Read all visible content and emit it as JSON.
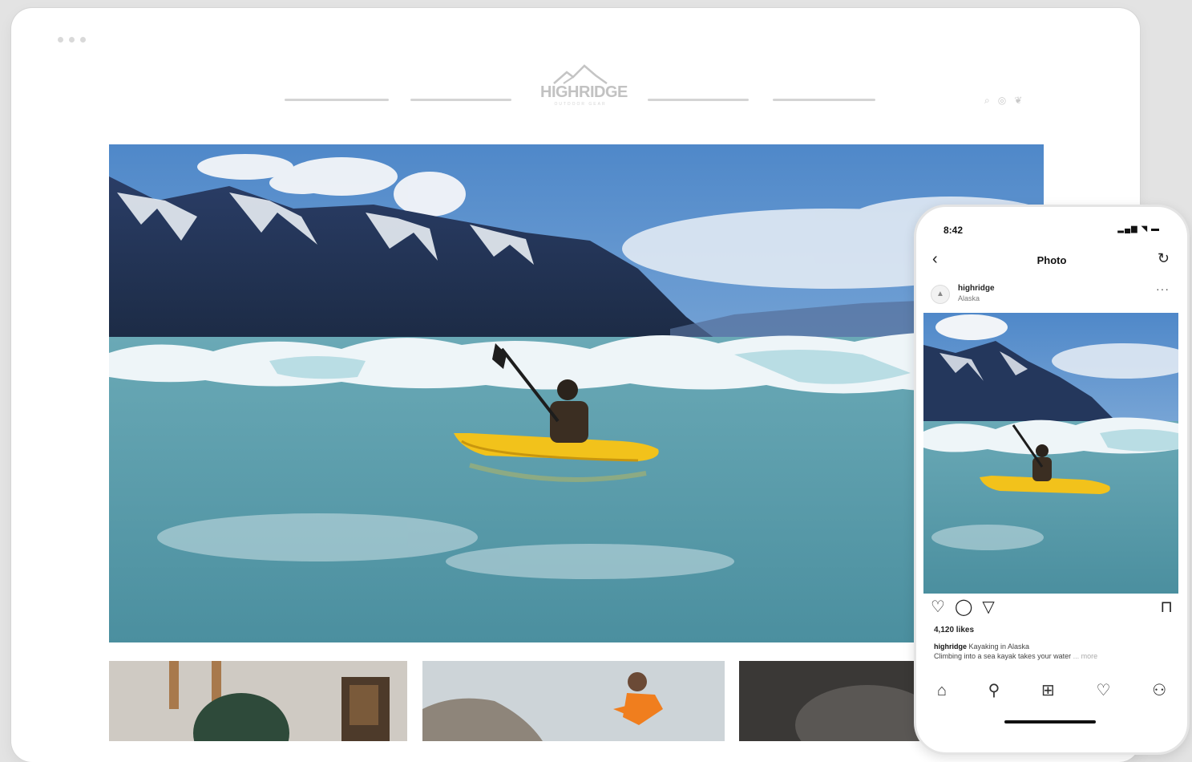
{
  "logo": {
    "name": "HIGHRIDGE",
    "tagline": "OUTDOOR GEAR"
  },
  "nav_icons": [
    "search-icon",
    "instagram-icon",
    "twitter-icon"
  ],
  "phone": {
    "status_time": "8:42",
    "title": "Photo",
    "user": {
      "name": "highridge",
      "location": "Alaska"
    },
    "likes": "4,120 likes",
    "caption_user": "highridge",
    "caption_text": "Kayaking in Alaska",
    "caption_line2": "Climbing into a sea kayak takes your water",
    "caption_more": "... more",
    "tabs": [
      "home-icon",
      "search-icon",
      "add-post-icon",
      "activity-heart-icon",
      "profile-icon"
    ]
  }
}
